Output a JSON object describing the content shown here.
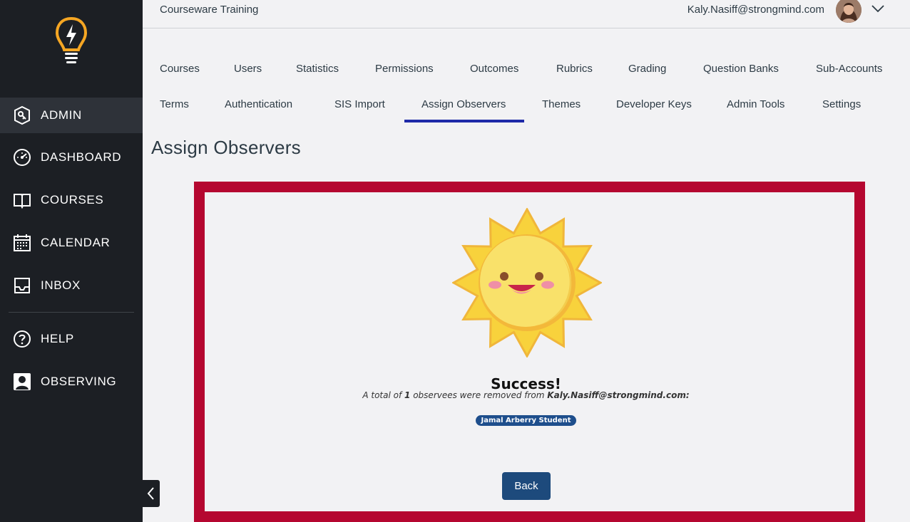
{
  "sidebar": {
    "items": [
      {
        "label": "ADMIN",
        "icon": "admin-shield-icon"
      },
      {
        "label": "DASHBOARD",
        "icon": "dashboard-gauge-icon"
      },
      {
        "label": "COURSES",
        "icon": "book-icon"
      },
      {
        "label": "CALENDAR",
        "icon": "calendar-icon"
      },
      {
        "label": "INBOX",
        "icon": "inbox-tray-icon"
      },
      {
        "label": "HELP",
        "icon": "help-question-icon"
      },
      {
        "label": "OBSERVING",
        "icon": "observing-person-icon"
      }
    ],
    "active": "ADMIN"
  },
  "header": {
    "title": "Courseware Training",
    "user_email": "Kaly.Nasiff@strongmind.com"
  },
  "tabs": {
    "row1": [
      "Courses",
      "Users",
      "Statistics",
      "Permissions",
      "Outcomes",
      "Rubrics",
      "Grading",
      "Question Banks",
      "Sub-Accounts"
    ],
    "row2": [
      "Terms",
      "Authentication",
      "SIS Import",
      "Assign Observers",
      "Themes",
      "Developer Keys",
      "Admin Tools",
      "Settings"
    ],
    "active": "Assign Observers"
  },
  "page": {
    "title": "Assign Observers"
  },
  "result": {
    "heading": "Success!",
    "message_prefix": "A total of",
    "count": "1",
    "message_middle": "observees were removed from",
    "user": "Kaly.Nasiff@strongmind.com:",
    "observee_badge": "Jamal Arberry Student",
    "back_label": "Back"
  },
  "colors": {
    "sidebar_bg": "#1c1f24",
    "accent_underline": "#1e2aa8",
    "frame_red": "#b50730",
    "button_blue": "#1d4a7c",
    "badge_blue": "#1e4e8c",
    "logo_orange": "#f5a623"
  }
}
